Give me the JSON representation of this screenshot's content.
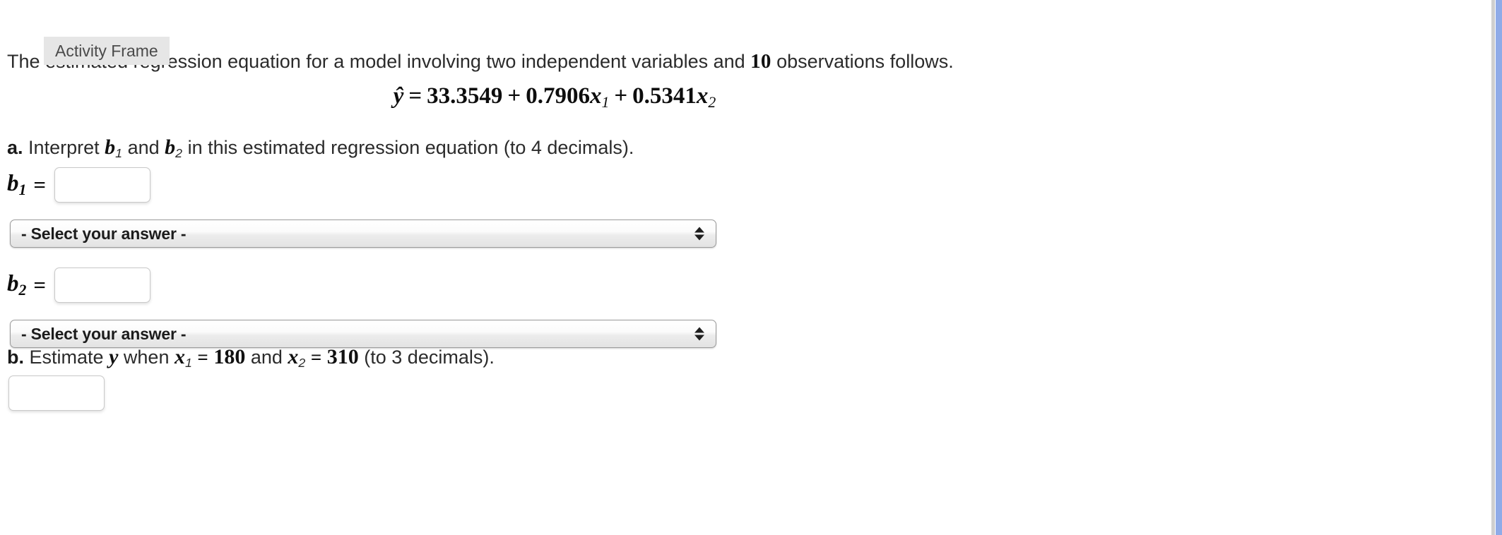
{
  "overlay": {
    "activity_frame_label": "Activity Frame"
  },
  "statement": {
    "prefix": "The estimated regression equation for a model involving two independent variables and",
    "observations": "10",
    "suffix": "observations follows."
  },
  "equation": {
    "lhs": "ŷ",
    "equals": "=",
    "intercept": "33.3549",
    "op1": "+",
    "coef1": "0.7906",
    "var1": "x",
    "var1_sub": "1",
    "op2": "+",
    "coef2": "0.5341",
    "var2": "x",
    "var2_sub": "2",
    "full_text": "ŷ = 33.3549 + 0.7906x₁ + 0.5341x₂"
  },
  "part_a": {
    "label": "a.",
    "text_1": "Interpret",
    "var_1": "b",
    "var_1_sub": "1",
    "text_2": "and",
    "var_2": "b",
    "var_2_sub": "2",
    "text_3": "in this estimated regression equation (to 4 decimals).",
    "full_text": "a. Interpret b₁ and b₂ in this estimated regression equation (to 4 decimals)."
  },
  "b1": {
    "label": "b",
    "label_sub": "1",
    "equals": "=",
    "value": "",
    "placeholder": ""
  },
  "b2": {
    "label": "b",
    "label_sub": "2",
    "equals": "=",
    "value": "",
    "placeholder": ""
  },
  "select_a": {
    "selected": "- Select your answer -",
    "options": [
      "- Select your answer -"
    ]
  },
  "select_b": {
    "selected": "- Select your answer -",
    "options": [
      "- Select your answer -"
    ]
  },
  "part_b": {
    "label": "b.",
    "text_1": "Estimate",
    "var_y": "y",
    "text_2": "when",
    "var_x1": "x",
    "var_x1_sub": "1",
    "eq1": "=",
    "val1": "180",
    "text_3": "and",
    "var_x2": "x",
    "var_x2_sub": "2",
    "eq2": "=",
    "val2": "310",
    "text_4": "(to 3 decimals).",
    "full_text": "b. Estimate y when x₁ = 180 and x₂ = 310 (to 3 decimals)."
  },
  "final_answer": {
    "value": "",
    "placeholder": ""
  },
  "colors": {
    "page_background": "#ffffff",
    "text": "#2b2b2b",
    "math_text": "#0d0d0d",
    "tooltip_background": "#e6e6e6",
    "tooltip_text": "#4a4a4a",
    "input_border": "#c9c9c9",
    "select_border": "#9b9b9b",
    "right_rule": "#cfcfcf",
    "right_band": "#8fabe8"
  }
}
